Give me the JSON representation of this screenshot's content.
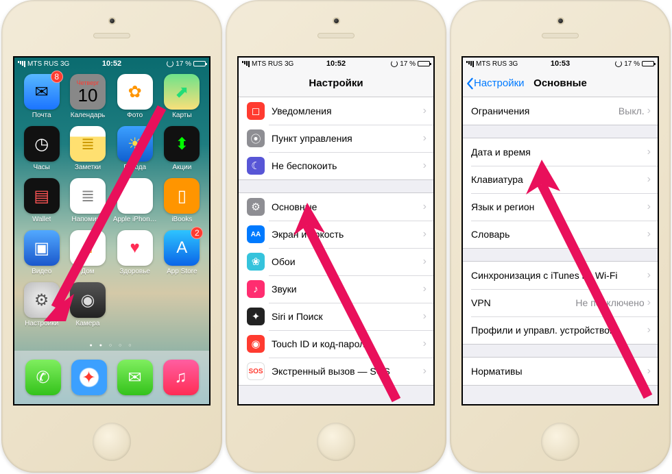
{
  "statusbar": {
    "carrier": "MTS RUS",
    "network": "3G",
    "battery_pct": "17 %",
    "time1": "10:52",
    "time2": "10:52",
    "time3": "10:53"
  },
  "home": {
    "apps": [
      {
        "id": "mail",
        "label": "Почта",
        "badge": "8"
      },
      {
        "id": "calendar",
        "label": "Календарь",
        "day": "Четверг",
        "num": "10"
      },
      {
        "id": "photos",
        "label": "Фото"
      },
      {
        "id": "maps",
        "label": "Карты"
      },
      {
        "id": "clock",
        "label": "Часы"
      },
      {
        "id": "notes",
        "label": "Заметки"
      },
      {
        "id": "weather",
        "label": "Погода"
      },
      {
        "id": "stocks",
        "label": "Акции"
      },
      {
        "id": "wallet",
        "label": "Wallet"
      },
      {
        "id": "reminders",
        "label": "Напомина"
      },
      {
        "id": "apple-iphone",
        "label": "Apple iPhon…"
      },
      {
        "id": "ibooks",
        "label": "iBooks"
      },
      {
        "id": "videos",
        "label": "Видео"
      },
      {
        "id": "home-app",
        "label": "Дом"
      },
      {
        "id": "health",
        "label": "Здоровье"
      },
      {
        "id": "appstore",
        "label": "App Store",
        "badge": "2"
      },
      {
        "id": "settings",
        "label": "Настройки"
      },
      {
        "id": "camera",
        "label": "Камера"
      }
    ],
    "dock": [
      {
        "id": "phone"
      },
      {
        "id": "safari"
      },
      {
        "id": "messages"
      },
      {
        "id": "music"
      }
    ]
  },
  "settings": {
    "title": "Настройки",
    "groups": [
      [
        {
          "icon_color": "#ff3b30",
          "glyph": "◻",
          "label": "Уведомления"
        },
        {
          "icon_color": "#8e8e93",
          "glyph": "⦿",
          "label": "Пункт управления"
        },
        {
          "icon_color": "#5856d6",
          "glyph": "☾",
          "label": "Не беспокоить"
        }
      ],
      [
        {
          "icon_color": "#8e8e93",
          "glyph": "⚙",
          "label": "Основные"
        },
        {
          "icon_color": "#007aff",
          "glyph": "AA",
          "label": "Экран и яркость"
        },
        {
          "icon_color": "#35c3dc",
          "glyph": "❀",
          "label": "Обои"
        },
        {
          "icon_color": "#ff2d70",
          "glyph": "♪",
          "label": "Звуки"
        },
        {
          "icon_color": "#222",
          "glyph": "✦",
          "label": "Siri и Поиск"
        },
        {
          "icon_color": "#ff3b30",
          "glyph": "◉",
          "label": "Touch ID и код-пароль"
        },
        {
          "icon_color": "#fff",
          "glyph": "SOS",
          "label": "Экстренный вызов — SOS",
          "glyph_color": "#ff3b30",
          "border": true
        }
      ]
    ]
  },
  "general": {
    "back": "Настройки",
    "title": "Основные",
    "groups": [
      [
        {
          "label": "Ограничения",
          "detail": "Выкл."
        }
      ],
      [
        {
          "label": "Дата и время"
        },
        {
          "label": "Клавиатура"
        },
        {
          "label": "Язык и регион"
        },
        {
          "label": "Словарь"
        }
      ],
      [
        {
          "label": "Синхронизация с iTunes по Wi-Fi"
        },
        {
          "label": "VPN",
          "detail": "Не подключено"
        },
        {
          "label": "Профили и управл. устройством"
        }
      ],
      [
        {
          "label": "Нормативы"
        }
      ]
    ]
  }
}
